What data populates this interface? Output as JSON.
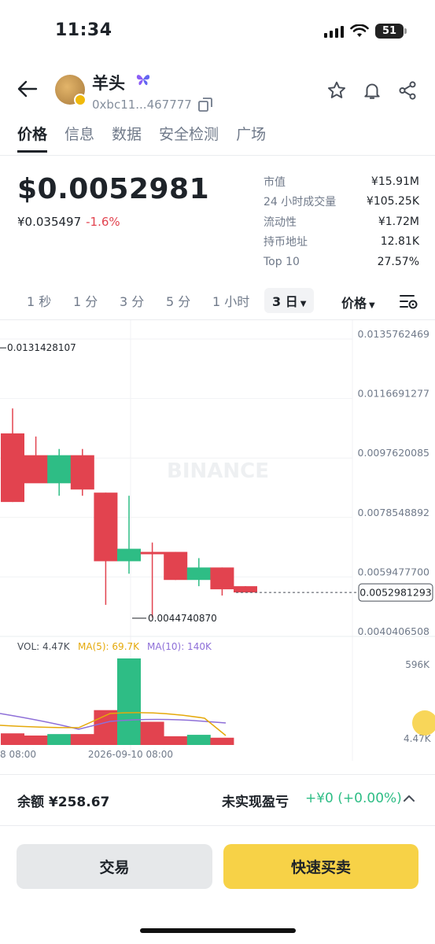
{
  "status": {
    "time": "11:34",
    "battery": "51"
  },
  "token": {
    "name": "羊头",
    "address": "0xbc11...467777"
  },
  "tabs": [
    {
      "label": "价格"
    },
    {
      "label": "信息"
    },
    {
      "label": "数据"
    },
    {
      "label": "安全检测"
    },
    {
      "label": "广场"
    }
  ],
  "price": {
    "main": "$0.0052981",
    "cny": "¥0.035497",
    "change": "-1.6%"
  },
  "stats": [
    {
      "label": "市值",
      "value": "¥15.91M"
    },
    {
      "label": "24 小时成交量",
      "value": "¥105.25K"
    },
    {
      "label": "流动性",
      "value": "¥1.72M"
    },
    {
      "label": "持币地址",
      "value": "12.81K"
    },
    {
      "label": "Top 10",
      "value": "27.57%"
    }
  ],
  "intervals": [
    {
      "label": "1 秒"
    },
    {
      "label": "1 分"
    },
    {
      "label": "3 分"
    },
    {
      "label": "5 分"
    },
    {
      "label": "1 小时"
    },
    {
      "label": "3 日"
    }
  ],
  "price_selector": "价格",
  "chart_data": {
    "type": "candlestick",
    "y_axis_labels": [
      "0.0135762469",
      "0.0116691277",
      "0.0097620085",
      "0.0078548892",
      "0.0059477700",
      "0.0040406508"
    ],
    "high_marker": "0.0131428107",
    "low_marker": "0.0044740870",
    "current_price": "0.0052981293",
    "watermark": "BINANCE",
    "candles": [
      {
        "open": 0.0082,
        "high": 0.0112,
        "low": 0.0082,
        "close": 0.0104,
        "color": "red"
      },
      {
        "open": 0.0097,
        "high": 0.0103,
        "low": 0.0091,
        "close": 0.0088,
        "color": "red"
      },
      {
        "open": 0.0088,
        "high": 0.0099,
        "low": 0.0084,
        "close": 0.0097,
        "color": "green"
      },
      {
        "open": 0.0097,
        "high": 0.0099,
        "low": 0.0084,
        "close": 0.0086,
        "color": "red"
      },
      {
        "open": 0.0085,
        "high": 0.0085,
        "low": 0.0049,
        "close": 0.0063,
        "color": "red"
      },
      {
        "open": 0.0063,
        "high": 0.0084,
        "low": 0.0059,
        "close": 0.0067,
        "color": "green"
      },
      {
        "open": 0.0066,
        "high": 0.0069,
        "low": 0.0045,
        "close": 0.0066,
        "color": "red"
      },
      {
        "open": 0.0066,
        "high": 0.0066,
        "low": 0.0057,
        "close": 0.0057,
        "color": "red"
      },
      {
        "open": 0.0057,
        "high": 0.0064,
        "low": 0.0055,
        "close": 0.0061,
        "color": "green"
      },
      {
        "open": 0.0061,
        "high": 0.0061,
        "low": 0.0052,
        "close": 0.0054,
        "color": "red"
      },
      {
        "open": 0.0055,
        "high": 0.0055,
        "low": 0.0053,
        "close": 0.0053,
        "color": "red"
      }
    ],
    "volume": {
      "vol_label": "VOL: 4.47K",
      "ma5_label": "MA(5): 69.7K",
      "ma10_label": "MA(10): 140K",
      "max_label": "596K",
      "current_label": "4.47K",
      "bars": [
        {
          "value": 80,
          "color": "red"
        },
        {
          "value": 65,
          "color": "red"
        },
        {
          "value": 75,
          "color": "green"
        },
        {
          "value": 75,
          "color": "red"
        },
        {
          "value": 240,
          "color": "red"
        },
        {
          "value": 596,
          "color": "green"
        },
        {
          "value": 160,
          "color": "red"
        },
        {
          "value": 60,
          "color": "red"
        },
        {
          "value": 70,
          "color": "green"
        },
        {
          "value": 50,
          "color": "red"
        }
      ]
    },
    "x_labels": [
      "8 08:00",
      "2026-09-10 08:00"
    ]
  },
  "bottom": {
    "balance": "余额 ¥258.67",
    "pnl_label": "未实现盈亏",
    "pnl_value": "+¥0 (+0.00%)",
    "trade_label": "交易",
    "quick_label": "快速买卖"
  },
  "colors": {
    "up": "#2ebd85",
    "down": "#e2434f",
    "brand": "#f7d247"
  }
}
